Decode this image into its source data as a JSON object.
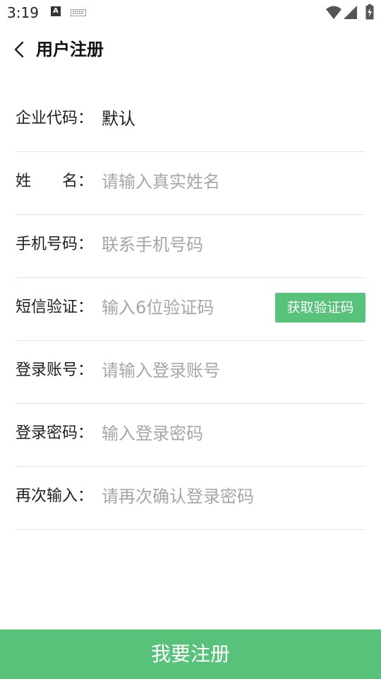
{
  "status_bar": {
    "time": "3:19",
    "icons": [
      "a-icon",
      "keyboard-icon",
      "wifi-icon",
      "signal-icon",
      "battery-icon"
    ]
  },
  "header": {
    "title": "用户注册",
    "back_icon": "chevron-left-icon"
  },
  "form": {
    "company_code": {
      "label": "企业代码：",
      "value": "默认"
    },
    "name": {
      "label": "姓　　名：",
      "placeholder": "请输入真实姓名"
    },
    "phone": {
      "label": "手机号码：",
      "placeholder": "联系手机号码"
    },
    "sms": {
      "label": "短信验证：",
      "placeholder": "输入6位验证码",
      "button_label": "获取验证码"
    },
    "account": {
      "label": "登录账号：",
      "placeholder": "请输入登录账号"
    },
    "password": {
      "label": "登录密码：",
      "placeholder": "输入登录密码"
    },
    "confirm_password": {
      "label": "再次输入：",
      "placeholder": "请再次确认登录密码"
    }
  },
  "submit": {
    "label": "我要注册"
  },
  "colors": {
    "accent": "#58c17a",
    "placeholder": "#a6a6a6",
    "divider": "#e6e6e6"
  }
}
